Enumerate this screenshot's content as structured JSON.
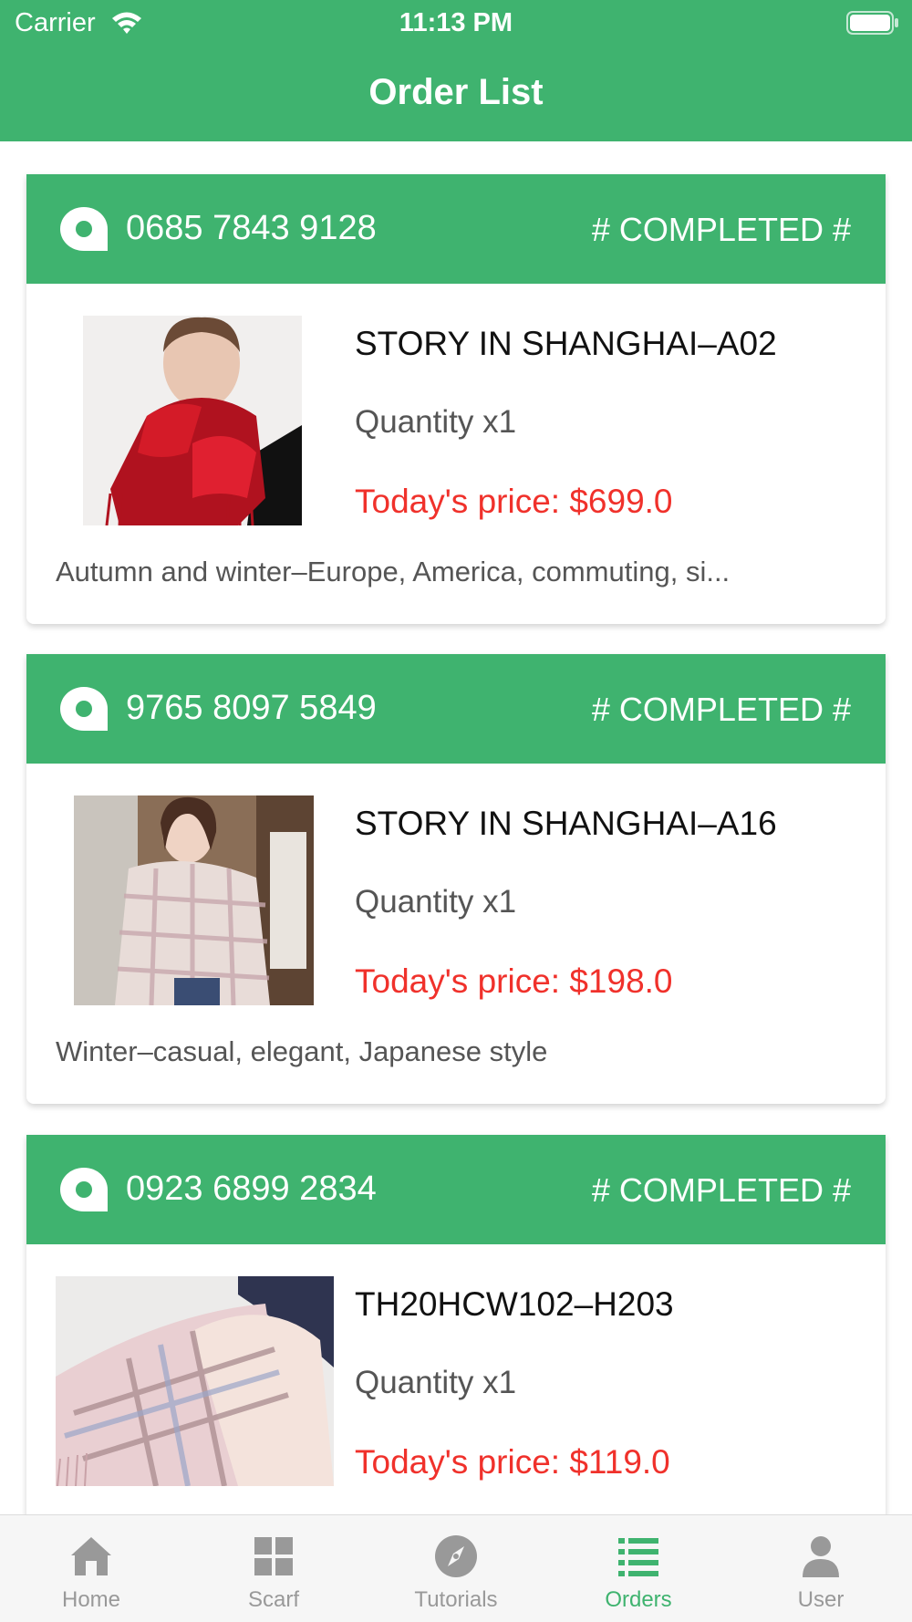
{
  "status_bar": {
    "carrier": "Carrier",
    "time": "11:13 PM"
  },
  "header": {
    "title": "Order List"
  },
  "orders": [
    {
      "number": "0685 7843 9128",
      "status": "# COMPLETED #",
      "product_name": "STORY IN SHANGHAI–A02",
      "quantity": "Quantity x1",
      "price": "Today's price: $699.0",
      "description": "Autumn and winter–Europe, America, commuting, si..."
    },
    {
      "number": "9765 8097 5849",
      "status": "# COMPLETED #",
      "product_name": "STORY IN SHANGHAI–A16",
      "quantity": "Quantity x1",
      "price": "Today's price: $198.0",
      "description": "Winter–casual, elegant, Japanese style"
    },
    {
      "number": "0923 6899 2834",
      "status": "# COMPLETED #",
      "product_name": "TH20HCW102–H203",
      "quantity": "Quantity x1",
      "price": "Today's price: $119.0",
      "description": ""
    }
  ],
  "tabbar": {
    "tabs": [
      {
        "label": "Home",
        "icon": "home-icon"
      },
      {
        "label": "Scarf",
        "icon": "grid-icon"
      },
      {
        "label": "Tutorials",
        "icon": "compass-icon"
      },
      {
        "label": "Orders",
        "icon": "list-icon",
        "active": true
      },
      {
        "label": "User",
        "icon": "user-icon"
      }
    ]
  },
  "colors": {
    "accent": "#3fb36f",
    "price": "#f0312b",
    "tab_inactive": "#999999"
  }
}
